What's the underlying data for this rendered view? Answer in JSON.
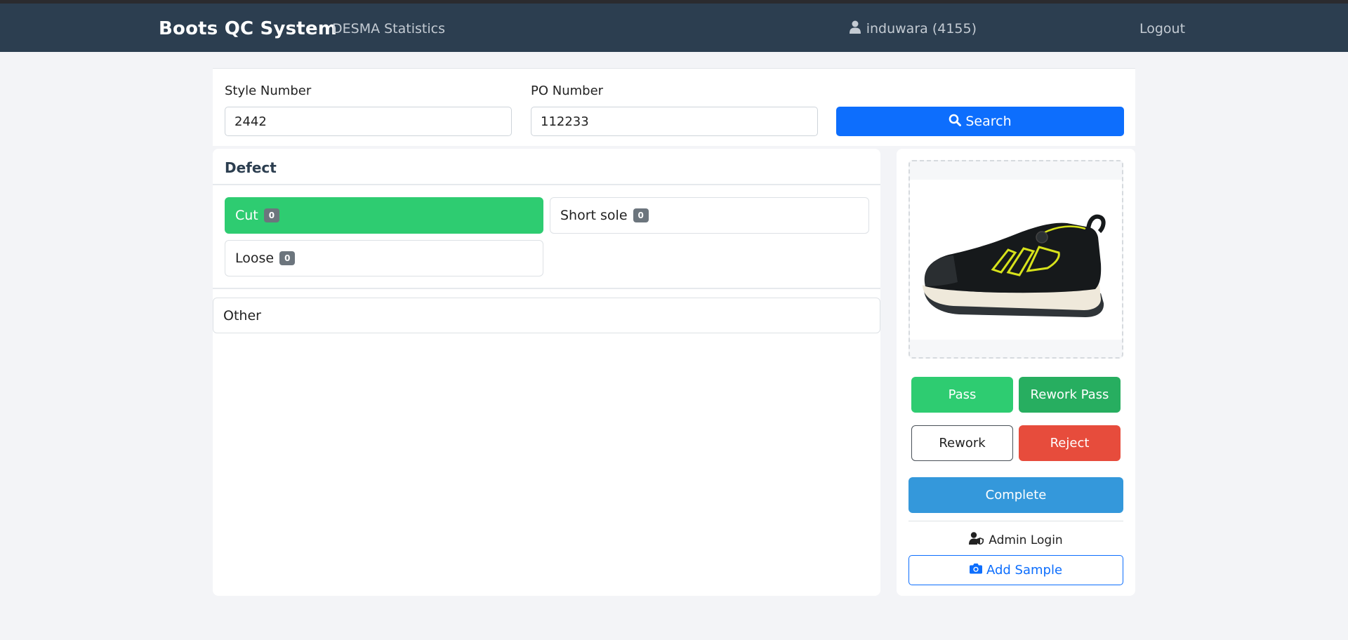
{
  "navbar": {
    "brand": "Boots QC System",
    "stats_link": "DESMA Statistics",
    "user": "induwara (4155)",
    "logout": "Logout"
  },
  "search": {
    "style_label": "Style Number",
    "style_value": "2442",
    "po_label": "PO Number",
    "po_value": "112233",
    "button_label": "Search"
  },
  "defects": {
    "title": "Defect",
    "items": [
      {
        "label": "Cut",
        "count": "0",
        "active": true
      },
      {
        "label": "Short sole",
        "count": "0",
        "active": false
      },
      {
        "label": "Loose",
        "count": "0",
        "active": false
      }
    ],
    "other_label": "Other"
  },
  "actions": {
    "pass": "Pass",
    "rework_pass": "Rework Pass",
    "rework": "Rework",
    "reject": "Reject",
    "complete": "Complete",
    "admin_login": "Admin Login",
    "add_sample": "Add Sample"
  },
  "colors": {
    "navbar": "#2c3e50",
    "primary": "#0d6efd",
    "pass": "#2ecc71",
    "rework_pass": "#27ae60",
    "reject": "#e74c3c",
    "complete": "#3498db"
  },
  "icons": {
    "user": "user-icon",
    "search": "search-icon",
    "admin": "user-shield-icon",
    "camera": "camera-icon"
  }
}
